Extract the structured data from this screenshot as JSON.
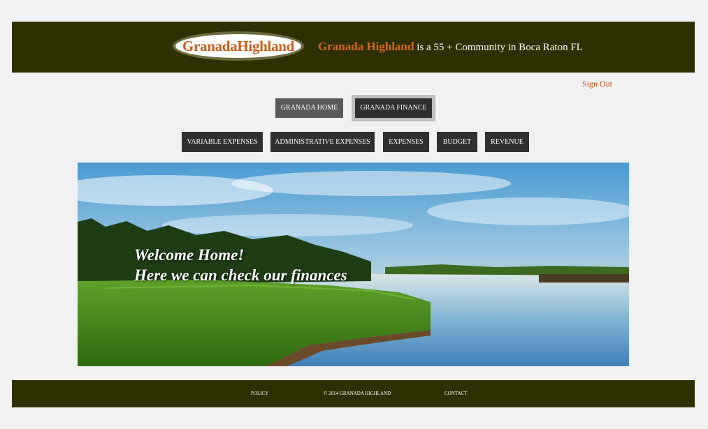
{
  "header": {
    "logo_text": "GranadaHighland",
    "tagline_brand": "Granada Highland",
    "tagline_rest": " is a 55 + Community in Boca Raton FL"
  },
  "account": {
    "sign_out": "Sign Out"
  },
  "main_nav": {
    "home": "GRANADA HOME",
    "finance": "GRANADA FINANCE",
    "selected": "GRANADA FINANCE"
  },
  "sub_nav": [
    "VARIABLE EXPENSES",
    "ADMINISTRATIVE EXPENSES",
    "EXPENSES",
    "BUDGET",
    "REVENUE"
  ],
  "hero": {
    "line1": "Welcome Home!",
    "line2": "Here we can check our finances"
  },
  "footer": {
    "policy": "POLICY",
    "copyright": "© 2014   GRANADA HIGHLAND",
    "contact": "CONTACT"
  },
  "colors": {
    "header_bg": "#2f3000",
    "brand_orange": "#c8601a",
    "button_dark": "#2f2f2f",
    "page_bg": "#f2f1f2"
  }
}
